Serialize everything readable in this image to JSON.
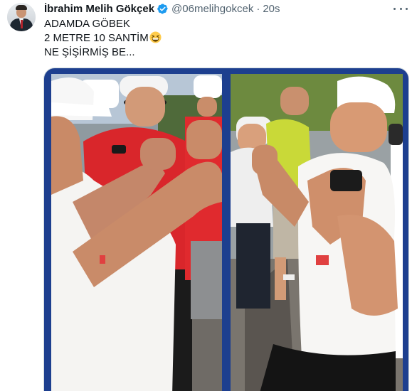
{
  "author": {
    "display_name": "İbrahim Melih Gökçek",
    "handle": "@06melihgokcek",
    "separator": "·",
    "time": "20s",
    "verified": true,
    "verified_color": "#1d9bf0"
  },
  "tweet": {
    "lines": [
      "ADAMDA GÖBEK",
      "2 METRE 10 SANTİM",
      "NE ŞİŞİRMİŞ BE..."
    ],
    "emoji": "grinning-squinting-face"
  },
  "media": {
    "frame_color": "#1d3f8f",
    "panels": [
      "left-video-frame",
      "right-video-frame"
    ]
  },
  "icons": {
    "more": "more-horizontal-icon",
    "verified": "verified-badge-icon"
  }
}
